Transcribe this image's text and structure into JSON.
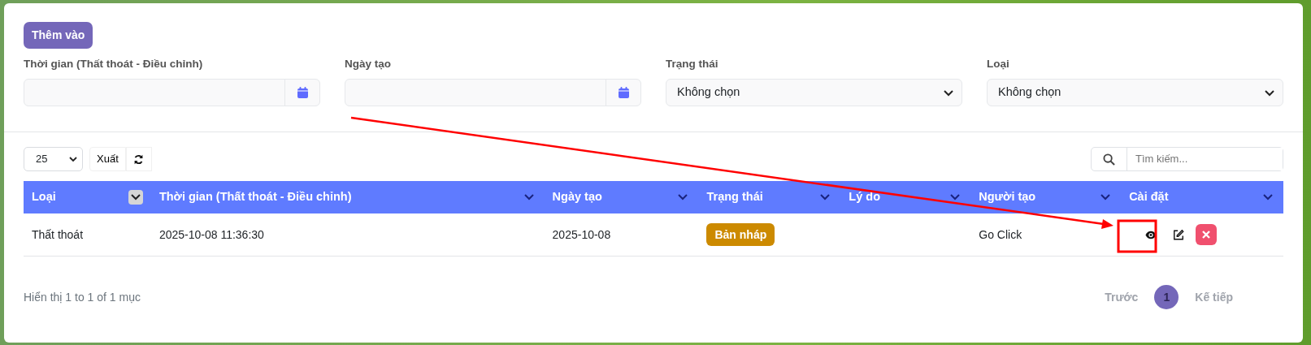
{
  "add_button": "Thêm vào",
  "filters": [
    {
      "label": "Thời gian (Thất thoát - Điều chỉnh)",
      "kind": "date"
    },
    {
      "label": "Ngày tạo",
      "kind": "date"
    },
    {
      "label": "Trạng thái",
      "kind": "select",
      "value": "Không chọn"
    },
    {
      "label": "Loại",
      "kind": "select",
      "value": "Không chọn"
    }
  ],
  "toolbar": {
    "page_size": "25",
    "export": "Xuất",
    "search": {
      "placeholder": "Tìm kiếm..."
    }
  },
  "table": {
    "columns": [
      {
        "label": "Loại",
        "sorted": true
      },
      {
        "label": "Thời gian (Thất thoát - Điều chỉnh)",
        "sorted": false
      },
      {
        "label": "Ngày tạo",
        "sorted": false
      },
      {
        "label": "Trạng thái",
        "sorted": false
      },
      {
        "label": "Lý do",
        "sorted": false
      },
      {
        "label": "Người tạo",
        "sorted": false
      },
      {
        "label": "Cài đặt",
        "sorted": false
      }
    ],
    "rows": [
      {
        "type": "Thất thoát",
        "time": "2025-10-08 11:36:30",
        "created": "2025-10-08",
        "status": {
          "label": "Bản nháp",
          "kind": "draft"
        },
        "creator": "Go Click"
      }
    ]
  },
  "footer": {
    "info": "Hiển thị 1 to 1 of 1 mục",
    "pagination": [
      {
        "label": "Trước",
        "kind": "prev",
        "selected": false
      },
      {
        "label": "1",
        "kind": "page",
        "selected": true
      },
      {
        "label": "Kế tiếp",
        "kind": "next",
        "selected": false
      }
    ]
  },
  "annotation": {
    "arrow": true,
    "highlight_box": true
  }
}
